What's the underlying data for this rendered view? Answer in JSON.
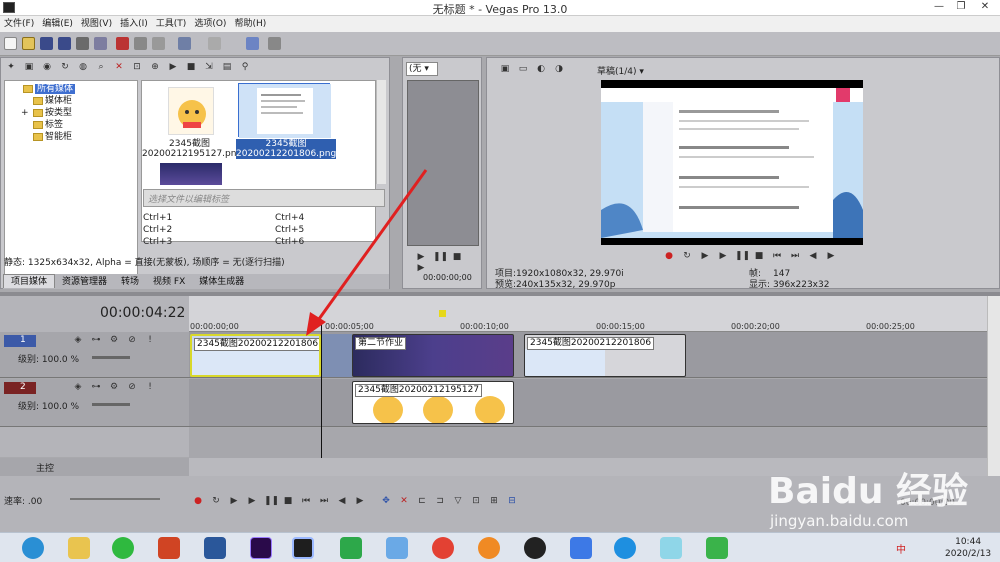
{
  "window": {
    "title": "无标题 * - Vegas Pro 13.0",
    "minimize": "—",
    "restore": "❐",
    "close": "✕"
  },
  "menu": [
    "文件(F)",
    "编辑(E)",
    "视图(V)",
    "插入(I)",
    "工具(T)",
    "选项(O)",
    "帮助(H)"
  ],
  "media_tree": {
    "items": [
      "所有媒体",
      "媒体柜",
      "按类型",
      "标签",
      "智能柜"
    ],
    "expander": "+"
  },
  "media_files": [
    {
      "name_line1": "2345截图",
      "name_line2": "20200212195127.png"
    },
    {
      "name_line1": "2345截图",
      "name_line2": "20200212201806.png"
    }
  ],
  "tag_placeholder": "选择文件以编辑标签",
  "shortcuts": [
    "Ctrl+1",
    "Ctrl+4",
    "Ctrl+2",
    "Ctrl+5",
    "Ctrl+3",
    "Ctrl+6"
  ],
  "media_status": "静态: 1325x634x32, Alpha = 直接(无蒙板), 场顺序 = 无(逐行扫描)",
  "left_tabs": [
    "项目媒体",
    "资源管理器",
    "转场",
    "视频 FX",
    "媒体生成器"
  ],
  "trimmer": {
    "dropdown": "(无",
    "timecode": "00:00:00;00"
  },
  "preview": {
    "quality": "草稿(1/4)",
    "project_label": "项目:",
    "project_value": "1920x1080x32, 29.970i",
    "preview_label": "预览:",
    "preview_value": "240x135x32, 29.970p",
    "frame_label": "帧:",
    "frame_value": "147",
    "display_label": "显示:",
    "display_value": "396x223x32"
  },
  "timeline": {
    "current_time": "00:00:04:22",
    "ruler_ticks": [
      "00:00:00;00",
      "00:00:05;00",
      "00:00:10;00",
      "00:00:15;00",
      "00:00:20;00",
      "00:00:25;00"
    ],
    "tracks": [
      {
        "number": "1",
        "level": "级别: 100.0 %"
      },
      {
        "number": "2",
        "level": "级别: 100.0 %"
      }
    ],
    "master_label": "主控",
    "rate": "速率: .00",
    "clips_track1": [
      "2345截图20200212201806",
      "第二节作业",
      "2345截图20200212201806"
    ],
    "clips_track2": [
      "2345截图20200212195127"
    ],
    "end_time": "00:00:00;00"
  },
  "watermark": {
    "text": "Baidu 经验",
    "url": "jingyan.baidu.com"
  },
  "taskbar": {
    "time": "10:44",
    "date": "2020/2/13",
    "ime": "中"
  },
  "colors": {
    "accent_red": "#e02020",
    "selection": "#2f5fb0",
    "clip_yellow": "#d8d82a"
  }
}
